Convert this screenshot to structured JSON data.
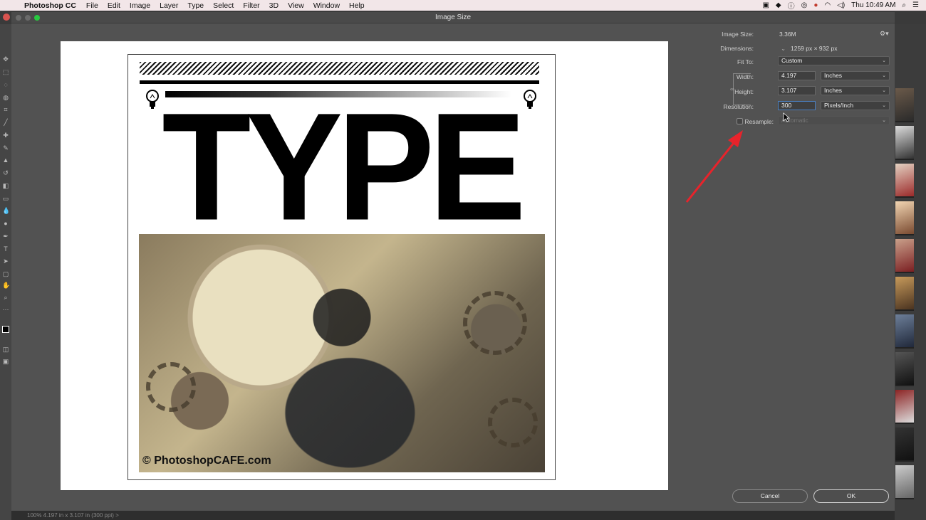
{
  "menubar": {
    "app_name": "Photoshop CC",
    "menus": [
      "File",
      "Edit",
      "Image",
      "Layer",
      "Type",
      "Select",
      "Filter",
      "3D",
      "View",
      "Window",
      "Help"
    ],
    "clock": "Thu 10:49 AM"
  },
  "dialog": {
    "title": "Image Size",
    "image_size_label": "Image Size:",
    "image_size_value": "3.36M",
    "dimensions_label": "Dimensions:",
    "dimensions_value": "1259 px  ×  932 px",
    "fit_to_label": "Fit To:",
    "fit_to_value": "Custom",
    "width_label": "Width:",
    "width_value": "4.197",
    "width_unit": "Inches",
    "height_label": "Height:",
    "height_value": "3.107",
    "height_unit": "Inches",
    "resolution_label": "Resolution:",
    "resolution_value": "300",
    "resolution_unit": "Pixels/Inch",
    "resample_label": "Resample:",
    "resample_value": "Automatic",
    "resample_checked": false,
    "cancel_label": "Cancel",
    "ok_label": "OK"
  },
  "preview": {
    "headline": "TYPE",
    "photo_credit": "© PhotoshopCAFE.com"
  },
  "statusbar": {
    "text": "100%     4.197 in x 3.107 in (300 ppi)     >"
  },
  "colors": {
    "annotation_arrow": "#e8232b",
    "dialog_bg": "#525252",
    "ok_border": "#cfcfcf"
  },
  "icons": [
    "apple-icon",
    "search-icon",
    "wifi-icon",
    "volume-icon",
    "gear-icon",
    "link-icon",
    "chevron-down-icon",
    "lightbulb-icon"
  ]
}
